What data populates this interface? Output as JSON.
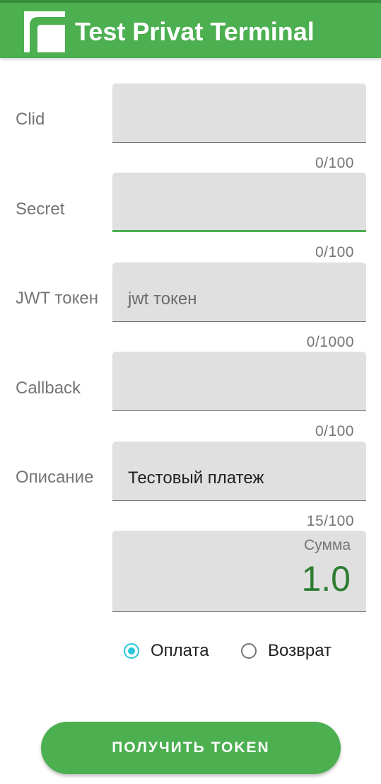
{
  "app": {
    "title": "Test Privat Terminal",
    "logo_icon": "privatbank-logo-icon",
    "brand_color": "#4caf50",
    "brand_dark_color": "#388e3c"
  },
  "form": {
    "fields": [
      {
        "label": "Clid",
        "value": "",
        "placeholder": "",
        "counter": "0/100"
      },
      {
        "label": "Secret",
        "value": "",
        "placeholder": "",
        "counter": "0/100",
        "focused": true
      },
      {
        "label": "JWT токен",
        "value": "",
        "placeholder": "jwt токен",
        "counter": "0/1000"
      },
      {
        "label": "Callback",
        "value": "",
        "placeholder": "",
        "counter": "0/100"
      },
      {
        "label": "Описание",
        "value": "Тестовый платеж",
        "placeholder": "",
        "counter": "15/100"
      }
    ],
    "amount": {
      "label": "Сумма",
      "value": "1.0",
      "value_color": "#2e7d32"
    }
  },
  "operation": {
    "options": [
      {
        "label": "Оплата",
        "checked": true
      },
      {
        "label": "Возврат",
        "checked": false
      }
    ],
    "accent_color": "#26c6da"
  },
  "actions": {
    "get_token_label": "ПОЛУЧИТЬ TOKEN"
  }
}
